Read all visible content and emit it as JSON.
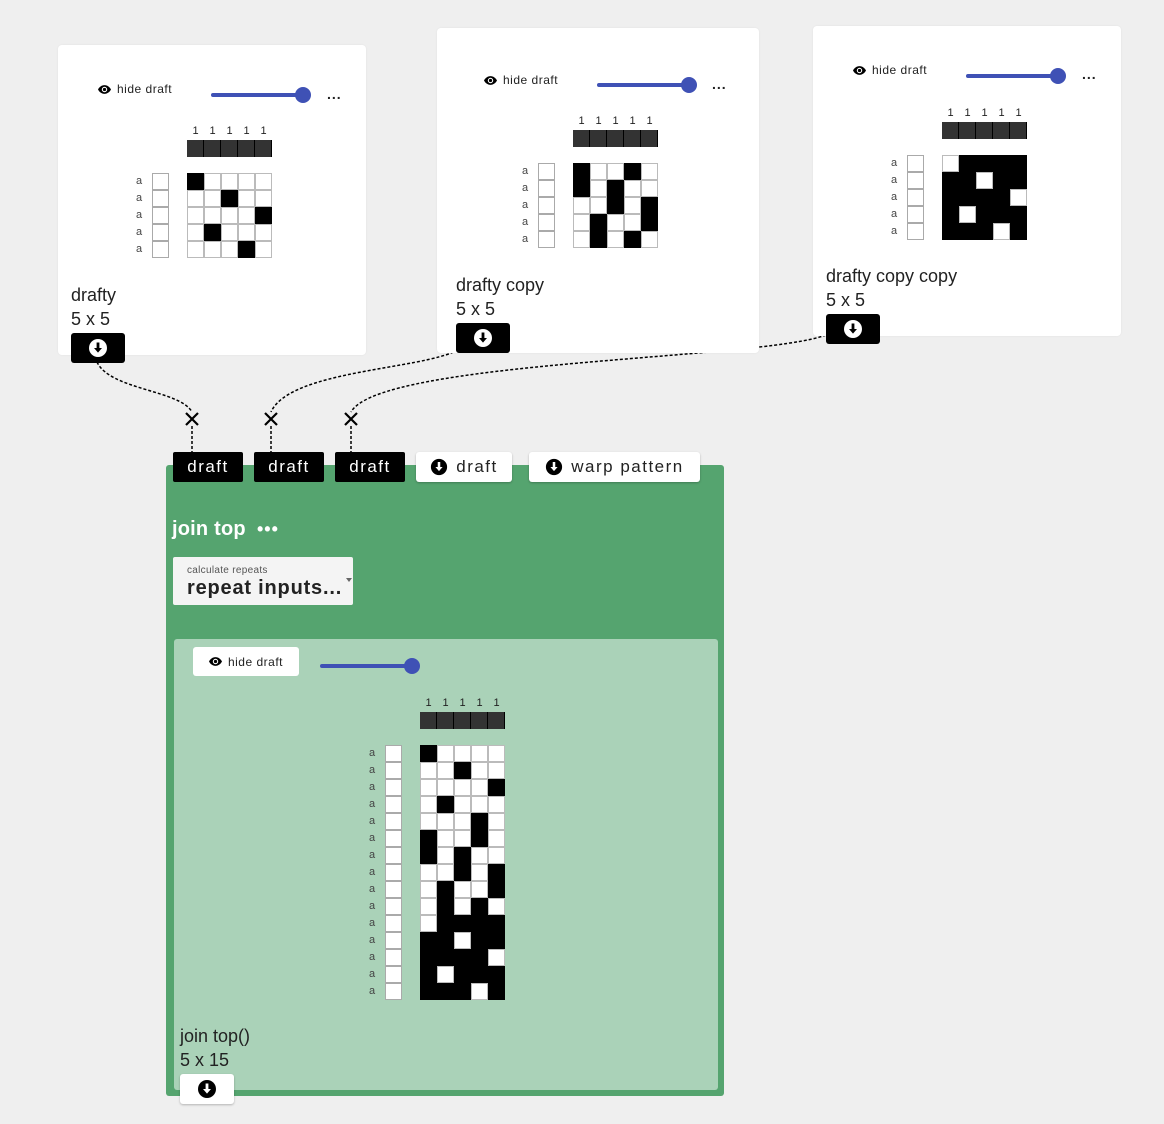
{
  "colors": {
    "accent": "#3f51b5",
    "op_bg": "#55a46f",
    "op_inner_bg": "#aad2b8",
    "canvas": "#efefef"
  },
  "drafts": [
    {
      "hide_label": "hide draft",
      "name": "drafty",
      "size": "5 x 5",
      "col_numbers": [
        "1",
        "1",
        "1",
        "1",
        "1"
      ],
      "row_labels": [
        "a",
        "a",
        "a",
        "a",
        "a"
      ],
      "cells": [
        [
          1,
          0,
          0,
          0,
          0
        ],
        [
          0,
          0,
          1,
          0,
          0
        ],
        [
          0,
          0,
          0,
          0,
          1
        ],
        [
          0,
          1,
          0,
          0,
          0
        ],
        [
          0,
          0,
          0,
          1,
          0
        ]
      ]
    },
    {
      "hide_label": "hide draft",
      "name": "drafty copy",
      "size": "5 x 5",
      "col_numbers": [
        "1",
        "1",
        "1",
        "1",
        "1"
      ],
      "row_labels": [
        "a",
        "a",
        "a",
        "a",
        "a"
      ],
      "cells": [
        [
          1,
          0,
          0,
          1,
          0
        ],
        [
          1,
          0,
          1,
          0,
          0
        ],
        [
          0,
          0,
          1,
          0,
          1
        ],
        [
          0,
          1,
          0,
          0,
          1
        ],
        [
          0,
          1,
          0,
          1,
          0
        ]
      ]
    },
    {
      "hide_label": "hide draft",
      "name": "drafty copy copy",
      "size": "5 x 5",
      "col_numbers": [
        "1",
        "1",
        "1",
        "1",
        "1"
      ],
      "row_labels": [
        "a",
        "a",
        "a",
        "a",
        "a"
      ],
      "cells": [
        [
          0,
          1,
          1,
          1,
          1
        ],
        [
          1,
          1,
          0,
          1,
          1
        ],
        [
          1,
          1,
          1,
          1,
          0
        ],
        [
          1,
          0,
          1,
          1,
          1
        ],
        [
          1,
          1,
          1,
          0,
          1
        ]
      ]
    }
  ],
  "operation": {
    "inputs": [
      "draft",
      "draft",
      "draft"
    ],
    "outputs": [
      "draft",
      "warp pattern"
    ],
    "title": "join top",
    "menu": "•••",
    "param_label": "calculate repeats",
    "param_value": "repeat inputs...",
    "hide_label": "hide draft",
    "result_name": "join top()",
    "result_size": "5 x 15",
    "col_numbers": [
      "1",
      "1",
      "1",
      "1",
      "1"
    ],
    "row_labels": [
      "a",
      "a",
      "a",
      "a",
      "a",
      "a",
      "a",
      "a",
      "a",
      "a",
      "a",
      "a",
      "a",
      "a",
      "a"
    ],
    "cells": [
      [
        1,
        0,
        0,
        0,
        0
      ],
      [
        0,
        0,
        1,
        0,
        0
      ],
      [
        0,
        0,
        0,
        0,
        1
      ],
      [
        0,
        1,
        0,
        0,
        0
      ],
      [
        0,
        0,
        0,
        1,
        0
      ],
      [
        1,
        0,
        0,
        1,
        0
      ],
      [
        1,
        0,
        1,
        0,
        0
      ],
      [
        0,
        0,
        1,
        0,
        1
      ],
      [
        0,
        1,
        0,
        0,
        1
      ],
      [
        0,
        1,
        0,
        1,
        0
      ],
      [
        0,
        1,
        1,
        1,
        1
      ],
      [
        1,
        1,
        0,
        1,
        1
      ],
      [
        1,
        1,
        1,
        1,
        0
      ],
      [
        1,
        0,
        1,
        1,
        1
      ],
      [
        1,
        1,
        1,
        0,
        1
      ]
    ]
  },
  "icons": [
    "eye-icon",
    "download-icon",
    "close-icon",
    "ellipsis-icon"
  ]
}
